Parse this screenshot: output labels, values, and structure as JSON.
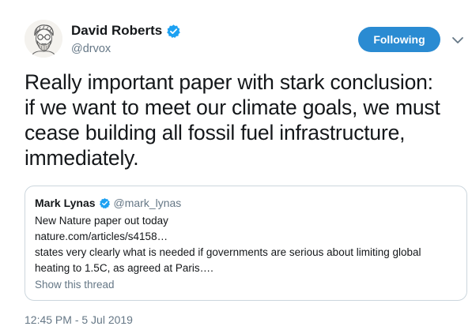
{
  "author": {
    "name": "David Roberts",
    "handle": "@drvox",
    "verified": true
  },
  "follow_button": {
    "label": "Following",
    "color": "#2a8bd2"
  },
  "menu_icon": "chevron-down-icon",
  "tweet": {
    "text": "Really important paper with stark conclusion:\nif we want to meet our climate goals, we must\ncease building all fossil fuel infrastructure,\nimmediately.",
    "timestamp": "12:45 PM - 5 Jul 2019"
  },
  "quoted_tweet": {
    "author_name": "Mark Lynas",
    "author_handle": "@mark_lynas",
    "verified": true,
    "lines": [
      "New Nature paper out today",
      "nature.com/articles/s4158…",
      "states very clearly what is needed if governments are serious about limiting global",
      "heating to 1.5C, as agreed at Paris…."
    ],
    "show_thread_label": "Show this thread"
  },
  "colors": {
    "verified_blue": "#1da1f2",
    "secondary_text": "#657786",
    "border": "#ccd6dd"
  }
}
